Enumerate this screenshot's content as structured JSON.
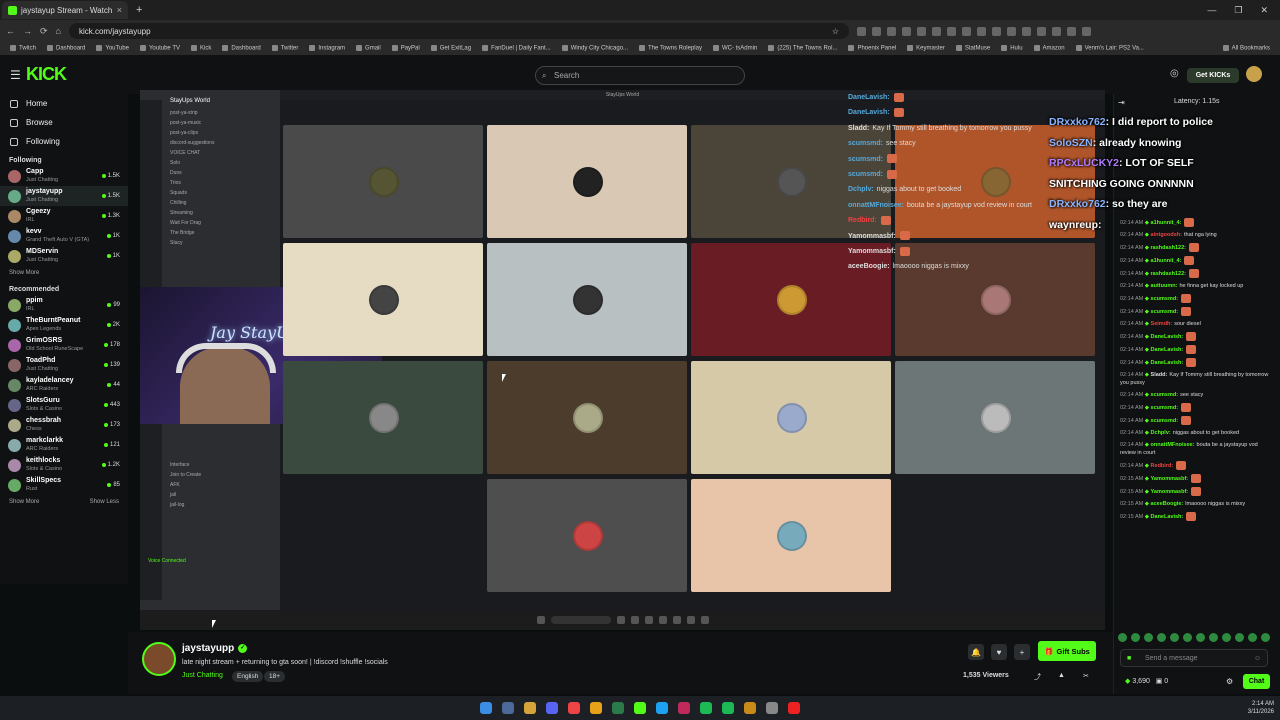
{
  "browser": {
    "tab_title": "jaystayup Stream - Watch",
    "url": "kick.com/jaystayupp",
    "bookmarks": [
      "Twitch",
      "Dashboard",
      "YouTube",
      "Youtube TV",
      "Kick",
      "Dashboard",
      "Twitter",
      "Instagram",
      "Gmail",
      "PayPal",
      "Get ExitLag",
      "FanDuel | Daily Fant...",
      "Windy City Chicago...",
      "The Towns Roleplay",
      "WC- tsAdmin",
      "(225) The Towns Rol...",
      "Phoenix Panel",
      "Keymaster",
      "StatMuse",
      "Hulu",
      "Amazon",
      "Venm's Lair: PS2 Va..."
    ],
    "all_bookmarks": "All Bookmarks"
  },
  "topbar": {
    "logo": "KICK",
    "search_placeholder": "Search",
    "get_kicks": "Get KICKs"
  },
  "sidebar": {
    "nav": [
      {
        "label": "Home",
        "icon": "home-icon"
      },
      {
        "label": "Browse",
        "icon": "browse-icon"
      },
      {
        "label": "Following",
        "icon": "heart-icon"
      }
    ],
    "following_header": "Following",
    "following": [
      {
        "name": "Capp",
        "game": "Just Chatting",
        "viewers": "1.5K"
      },
      {
        "name": "jaystayupp",
        "game": "Just Chatting",
        "viewers": "1.5K"
      },
      {
        "name": "Cgeezy",
        "game": "IRL",
        "viewers": "1.3K"
      },
      {
        "name": "kevv",
        "game": "Grand Theft Auto V (GTA)",
        "viewers": "1K"
      },
      {
        "name": "MDServin",
        "game": "Just Chatting",
        "viewers": "1K"
      }
    ],
    "show_more": "Show More",
    "recommended_header": "Recommended",
    "recommended": [
      {
        "name": "ppim",
        "game": "IRL",
        "viewers": "99"
      },
      {
        "name": "TheBurntPeanut",
        "game": "Apex Legends",
        "viewers": "2K"
      },
      {
        "name": "GrimOSRS",
        "game": "Old School RuneScape",
        "viewers": "178"
      },
      {
        "name": "ToadPhd",
        "game": "Just Chatting",
        "viewers": "139"
      },
      {
        "name": "kayladelancey",
        "game": "ARC Raiders",
        "viewers": "44"
      },
      {
        "name": "SlotsGuru",
        "game": "Slots & Casino",
        "viewers": "443"
      },
      {
        "name": "chessbrah",
        "game": "Chess",
        "viewers": "173"
      },
      {
        "name": "markclarkk",
        "game": "ARC Raiders",
        "viewers": "121"
      },
      {
        "name": "keithlocks",
        "game": "Slots & Casino",
        "viewers": "1.2K"
      },
      {
        "name": "SkillSpecs",
        "game": "Rust",
        "viewers": "85"
      }
    ],
    "show_more_2": "Show More",
    "show_less": "Show Less"
  },
  "stream": {
    "window_title": "StayUps World",
    "server_name": "StayUps World",
    "channels": [
      "post-ya-strip",
      "post-ya-music",
      "post-ya-clips",
      "discord-suggestions",
      "VOICE CHAT",
      "Solo",
      "Duos",
      "Trios",
      "Squads",
      "Chilling",
      "Streaming",
      "Wait For Drag",
      "The Bridge",
      "Stacy"
    ],
    "voice_channels": [
      "Interface",
      "Join to Create",
      "AFK",
      "jail",
      "jail-log"
    ],
    "voice_status": "Voice Connected",
    "webcam_text": "Jay StayUp",
    "overlay_chat": [
      {
        "user": "DaneLavish:",
        "text": "",
        "color": "#5ad"
      },
      {
        "user": "DaneLavish:",
        "text": "",
        "color": "#5ad"
      },
      {
        "user": "Sladd:",
        "text": "Kay If Tommy still breathing by tomorrow you pussy",
        "color": "#ddd"
      },
      {
        "user": "scumsmd:",
        "text": "see stacy",
        "color": "#5ad"
      },
      {
        "user": "scumsmd:",
        "text": "",
        "color": "#5ad"
      },
      {
        "user": "scumsmd:",
        "text": "",
        "color": "#5ad"
      },
      {
        "user": "Dchplv:",
        "text": "niggas about to get booked",
        "color": "#5ad"
      },
      {
        "user": "onnattMFnoisee:",
        "text": "bouta be a jaystayup vod review in court",
        "color": "#5ad"
      },
      {
        "user": "Redbird:",
        "text": "",
        "color": "#e44"
      },
      {
        "user": "Yamommasbf:",
        "text": "",
        "color": "#ddd"
      },
      {
        "user": "Yamommasbf:",
        "text": "",
        "color": "#ddd"
      },
      {
        "user": "aceeBoogie:",
        "text": "lmaoooo niggas is mixxy",
        "color": "#ddd"
      }
    ]
  },
  "info": {
    "streamer": "jaystayupp",
    "title": "late night stream + returning to gta soon! | !discord !shuffle !socials",
    "category": "Just Chatting",
    "tags": [
      "English",
      "18+"
    ],
    "viewers": "1,535 Viewers",
    "gift_subs": "Gift Subs"
  },
  "chat": {
    "latency": "Latency: 1.15s",
    "overlay_big": [
      {
        "user": "DRxxko762",
        "text": ": I did report to police",
        "color": "#8ab4ff"
      },
      {
        "user": "SoloSZN",
        "text": ": already knowing",
        "color": "#8ab4ff"
      },
      {
        "user": "RPCxLUCKY2",
        "text": ": LOT OF SELF",
        "color": "#b07cff"
      },
      {
        "user": "",
        "text": "SNITCHING GOING ONNNNN",
        "color": "#fff"
      },
      {
        "user": "DRxxko762",
        "text": ": so they are",
        "color": "#8ab4ff"
      },
      {
        "user": "waynreup",
        "text": ":",
        "color": "#fff"
      }
    ],
    "messages": [
      {
        "time": "02:14 AM",
        "user": "a1hunnit_4:",
        "text": "",
        "color": "#53fc18"
      },
      {
        "time": "02:14 AM",
        "user": "aintgoodsh:",
        "text": "that nga lying",
        "color": "#e44"
      },
      {
        "time": "02:14 AM",
        "user": "rashdash122:",
        "text": "",
        "color": "#53fc18"
      },
      {
        "time": "02:14 AM",
        "user": "a1hunnit_4:",
        "text": "",
        "color": "#53fc18"
      },
      {
        "time": "02:14 AM",
        "user": "rashdash122:",
        "text": "",
        "color": "#53fc18"
      },
      {
        "time": "02:14 AM",
        "user": "auttuumn:",
        "text": "he finna get kay locked up",
        "color": "#53fc18"
      },
      {
        "time": "02:14 AM",
        "user": "scumsmd:",
        "text": "",
        "color": "#53fc18"
      },
      {
        "time": "02:14 AM",
        "user": "scumsmd:",
        "text": "",
        "color": "#53fc18"
      },
      {
        "time": "02:14 AM",
        "user": "Seimdh:",
        "text": "sour diesel",
        "color": "#e44"
      },
      {
        "time": "02:14 AM",
        "user": "DaneLavish:",
        "text": "",
        "color": "#53fc18"
      },
      {
        "time": "02:14 AM",
        "user": "DaneLavish:",
        "text": "",
        "color": "#53fc18"
      },
      {
        "time": "02:14 AM",
        "user": "DaneLavish:",
        "text": "",
        "color": "#53fc18"
      },
      {
        "time": "02:14 AM",
        "user": "Sladd:",
        "text": "Kay If Tommy still breathing by tomorrow you pussy",
        "color": "#ddd"
      },
      {
        "time": "02:14 AM",
        "user": "scumsmd:",
        "text": "see stacy",
        "color": "#53fc18"
      },
      {
        "time": "02:14 AM",
        "user": "scumsmd:",
        "text": "",
        "color": "#53fc18"
      },
      {
        "time": "02:14 AM",
        "user": "scumsmd:",
        "text": "",
        "color": "#53fc18"
      },
      {
        "time": "02:14 AM",
        "user": "Dchplv:",
        "text": "niggas about to get booked",
        "color": "#53fc18"
      },
      {
        "time": "02:14 AM",
        "user": "onnattMFnoisee:",
        "text": "bouta be a jaystayup vod review in court",
        "color": "#53fc18"
      },
      {
        "time": "02:14 AM",
        "user": "Redbird:",
        "text": "",
        "color": "#e44"
      },
      {
        "time": "02:15 AM",
        "user": "Yamommasbf:",
        "text": "",
        "color": "#53fc18"
      },
      {
        "time": "02:15 AM",
        "user": "Yamommasbf:",
        "text": "",
        "color": "#53fc18"
      },
      {
        "time": "02:15 AM",
        "user": "aceeBoogie:",
        "text": "lmaoooo niggas is mixxy",
        "color": "#53fc18"
      },
      {
        "time": "02:15 AM",
        "user": "DaneLavish:",
        "text": "",
        "color": "#53fc18"
      }
    ],
    "send_placeholder": "Send a message",
    "kicks_balance": "3,690",
    "other_count": "0",
    "chat_button": "Chat"
  },
  "os": {
    "time": "2:14 AM",
    "date": "3/11/2026"
  }
}
